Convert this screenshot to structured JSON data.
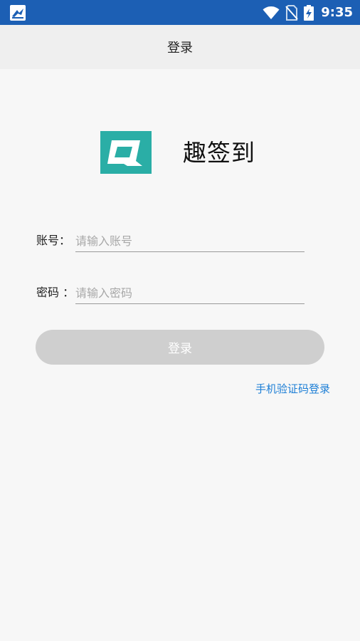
{
  "status_bar": {
    "time": "9:35",
    "background_color": "#1c5fb4",
    "icons": [
      "app-notification-icon",
      "wifi-icon",
      "no-sim-icon",
      "battery-charging-icon"
    ]
  },
  "header": {
    "title": "登录",
    "background_color": "#efefef"
  },
  "brand": {
    "logo_icon": "q-logo-icon",
    "logo_color": "#2aaea6",
    "app_name": "趣签到"
  },
  "form": {
    "account": {
      "label": "账号：",
      "placeholder": "请输入账号",
      "value": ""
    },
    "password": {
      "label": "密码 ：",
      "placeholder": "请输入密码",
      "value": ""
    },
    "submit_label": "登录",
    "submit_color": "#cfcfcf"
  },
  "links": {
    "sms_login": "手机验证码登录",
    "link_color": "#1e7fd6"
  }
}
